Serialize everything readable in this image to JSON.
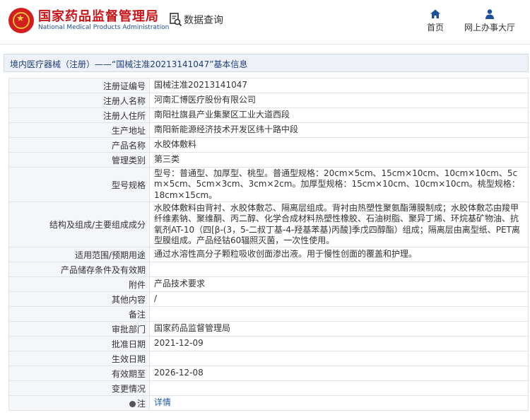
{
  "header": {
    "site_name": "国家药品监督管理局",
    "site_name_en": "National Medical Products Administration",
    "data_query": "数据查询",
    "nav": [
      {
        "label": "首页",
        "icon": "home-icon"
      },
      {
        "label": "网上办事大厅",
        "icon": "person-icon"
      }
    ]
  },
  "titlebar": {
    "text": "境内医疗器械（注册）——“国械注准20213141047”基本信息"
  },
  "rows": [
    {
      "label": "注册证编号",
      "value": "国械注准20213141047"
    },
    {
      "label": "注册人名称",
      "value": "河南汇博医疗股份有限公司"
    },
    {
      "label": "注册人住所",
      "value": "南阳社旗县产业集聚区工业大道西段"
    },
    {
      "label": "生产地址",
      "value": "南阳新能源经济技术开发区纬十路中段"
    },
    {
      "label": "产品名称",
      "value": "水胶体敷料"
    },
    {
      "label": "管理类别",
      "value": "第三类"
    },
    {
      "label": "型号规格",
      "value": "型号：普通型、加厚型、桃型。普通型规格：20cm×5cm、15cm×10cm、10cm×10cm、5cm×5cm、5cm×3cm、3cm×2cm。加厚型规格：15cm×10cm、10cm×10cm。桃型规格：18cm×15cm。"
    },
    {
      "label": "结构及组成/主要组成成分",
      "value": "水胶体敷料由背衬、水胶体敷芯、隔离层组成。背衬由热塑性聚氨酯薄膜制成；水胶体敷芯由羧甲纤维素钠、聚维酮、丙二醇、化学合成材料热塑性橡胶、石油树脂、聚异丁烯、环烷基矿物油、抗氧剂AT-10（四[β-(3，5-二叔丁基-4-羟基苯基)丙酸]季戊四醇酯）组成；隔离层由离型纸、PET离型膜组成。产品经钴60辐照灭菌，一次性使用。"
    },
    {
      "label": "适用范围/预期用途",
      "value": "通过水溶性高分子颗粒吸收创面渗出液。用于慢性创面的覆盖和护理。"
    },
    {
      "label": "产品储存条件及有效期",
      "value": ""
    },
    {
      "label": "附件",
      "value": "产品技术要求"
    },
    {
      "label": "其他内容",
      "value": "/"
    },
    {
      "label": "备注",
      "value": ""
    },
    {
      "label": "审批部门",
      "value": "国家药品监督管理局"
    },
    {
      "label": "批准日期",
      "value": "2021-12-09"
    },
    {
      "label": "生效日期",
      "value": ""
    },
    {
      "label": "有效期至",
      "value": "2026-12-08"
    },
    {
      "label": "变更情况",
      "value": ""
    },
    {
      "label": "注",
      "value": "详情"
    }
  ]
}
